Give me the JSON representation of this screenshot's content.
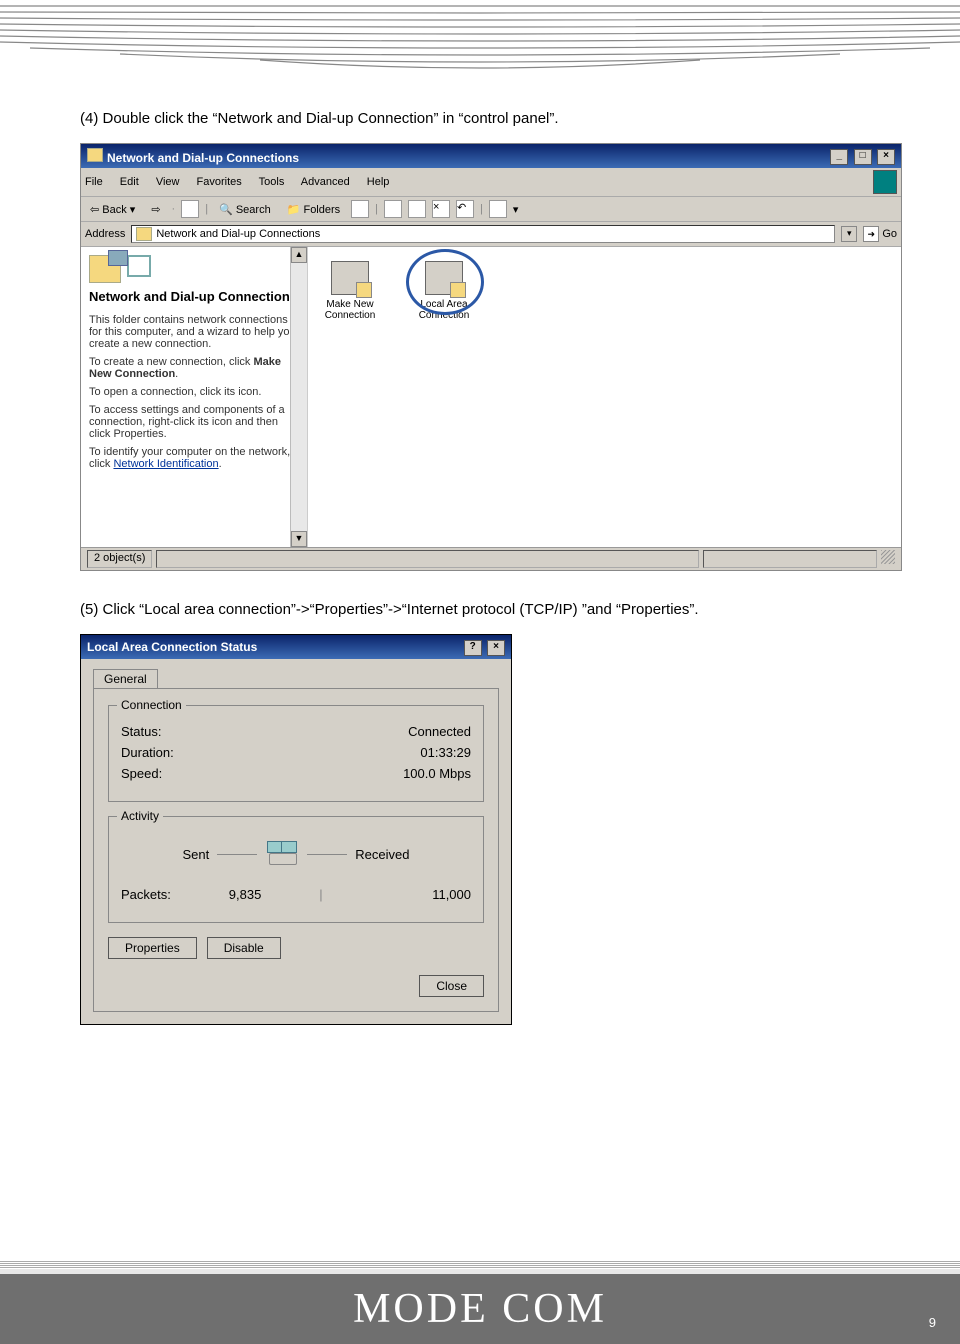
{
  "instruction1": "(4) Double click the “Network and Dial-up Connection” in “control panel”.",
  "instruction2": "(5) Click “Local area connection”->“Properties”->“Internet protocol (TCP/IP) ”and “Properties”.",
  "win1": {
    "title": "Network and Dial-up Connections",
    "menu": [
      "File",
      "Edit",
      "View",
      "Favorites",
      "Tools",
      "Advanced",
      "Help"
    ],
    "toolbar": {
      "back": "Back",
      "search": "Search",
      "folders": "Folders"
    },
    "addressLabel": "Address",
    "addressValue": "Network and Dial-up Connections",
    "go": "Go",
    "side": {
      "heading": "Network and Dial-up Connections",
      "p1": "This folder contains network connections for this computer, and a wizard to help you create a new connection.",
      "p2a": "To create a new connection, click ",
      "p2b": "Make New Connection",
      "p2c": ".",
      "p3": "To open a connection, click its icon.",
      "p4": "To access settings and components of a connection, right-click its icon and then click Properties.",
      "p5a": "To identify your computer on the network, click ",
      "p5b": "Network Identification",
      "p5c": "."
    },
    "icons": {
      "makeNew": "Make New Connection",
      "lac": "Local Area Connection"
    },
    "status": "2 object(s)"
  },
  "win2": {
    "title": "Local Area Connection Status",
    "tab": "General",
    "conn": {
      "legend": "Connection",
      "status_l": "Status:",
      "status_v": "Connected",
      "dur_l": "Duration:",
      "dur_v": "01:33:29",
      "speed_l": "Speed:",
      "speed_v": "100.0 Mbps"
    },
    "act": {
      "legend": "Activity",
      "sent": "Sent",
      "received": "Received",
      "pk_l": "Packets:",
      "pk_sent": "9,835",
      "pk_recv": "11,000"
    },
    "btn_props": "Properties",
    "btn_disable": "Disable",
    "btn_close": "Close"
  },
  "footer": {
    "logo": "MODE COM",
    "page": "9"
  }
}
